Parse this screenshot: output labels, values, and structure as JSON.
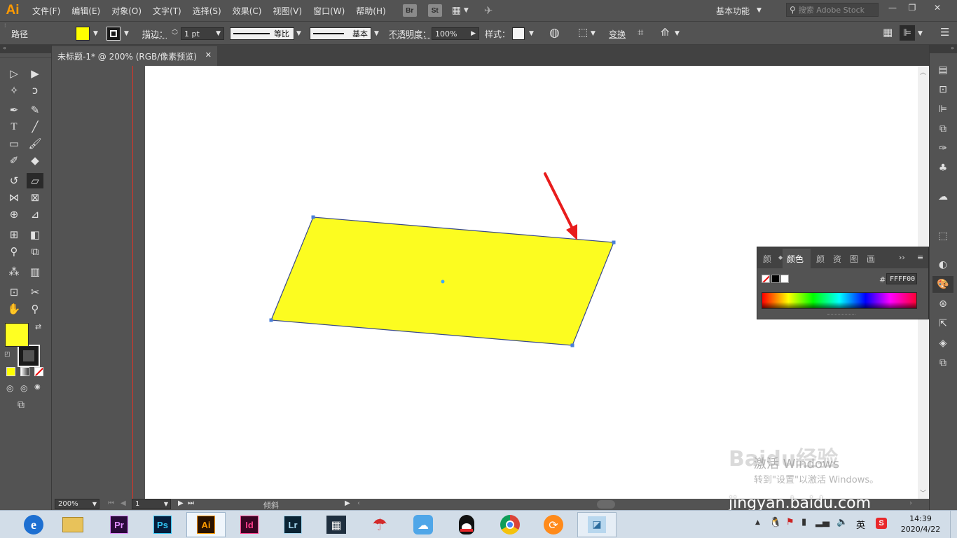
{
  "app": {
    "logo": "Ai",
    "menu": [
      "文件(F)",
      "编辑(E)",
      "对象(O)",
      "文字(T)",
      "选择(S)",
      "效果(C)",
      "视图(V)",
      "窗口(W)",
      "帮助(H)"
    ],
    "bridge_label": "Br",
    "stock_label": "St",
    "workspace": "基本功能",
    "search_placeholder": "搜索 Adobe Stock",
    "window_controls": [
      "—",
      "❐",
      "✕"
    ]
  },
  "control_bar": {
    "selection_type": "路径",
    "fill_color": "#FFFF00",
    "stroke_label": "描边：",
    "stroke_weight": "1 pt",
    "profile_label": "等比",
    "brush_label": "基本",
    "opacity_label": "不透明度：",
    "opacity_value": "100%",
    "style_label": "样式：",
    "transform_label": "变换"
  },
  "document": {
    "tab_title": "未标题-1* @ 200% (RGB/像素预览)",
    "close_glyph": "✕",
    "shape_fill": "#FCFC20",
    "shape_stroke": "#3a4a8a",
    "annotation_arrow_color": "#E81C1C"
  },
  "status_bar": {
    "zoom": "200%",
    "artboard_number": "1",
    "current_tool": "倾斜"
  },
  "color_panel": {
    "tabs": [
      "颜色",
      "颜色",
      "颜色参考",
      "资源",
      "图层",
      "画板"
    ],
    "active_tab": "颜色",
    "hex_prefix": "#",
    "hex_value": "FFFF00"
  },
  "watermark": {
    "activate_line1": "激活 Windows",
    "activate_line2": "转到\"设置\"以激活 Windows。",
    "baidu_text": "Baidu经验",
    "baidu_url": "jingyan.baidu.com"
  },
  "taskbar": {
    "apps": [
      {
        "name": "ie",
        "label": "e",
        "color": "#1d6fd1"
      },
      {
        "name": "explorer",
        "label": "",
        "color": "#e8c25a"
      },
      {
        "name": "premiere",
        "label": "Pr",
        "color": "#2a0a3a"
      },
      {
        "name": "photoshop",
        "label": "Ps",
        "color": "#061e3c"
      },
      {
        "name": "illustrator",
        "label": "Ai",
        "color": "#2a1300"
      },
      {
        "name": "indesign",
        "label": "Id",
        "color": "#3a0523"
      },
      {
        "name": "lightroom",
        "label": "Lr",
        "color": "#0b2434"
      },
      {
        "name": "video",
        "label": "▦",
        "color": "#1f2f3f"
      },
      {
        "name": "umbrella",
        "label": "☂",
        "color": "#ffffff"
      },
      {
        "name": "cat",
        "label": "☁",
        "color": "#4fa6e8"
      },
      {
        "name": "qq",
        "label": "🐧",
        "color": "#ffffff"
      },
      {
        "name": "chrome",
        "label": "",
        "color": "#ffffff"
      },
      {
        "name": "orange",
        "label": "⟳",
        "color": "#ff8a1a"
      },
      {
        "name": "notes",
        "label": "◪",
        "color": "#b8d7ee"
      }
    ],
    "tray_lang": "英",
    "time": "14:39",
    "date": "2020/4/22"
  }
}
